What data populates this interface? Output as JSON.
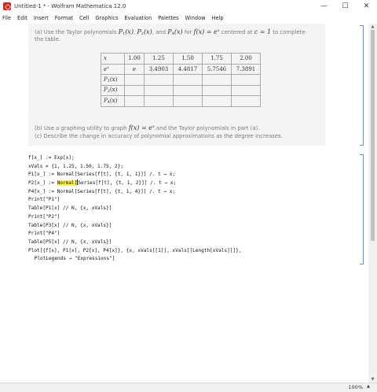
{
  "window": {
    "title": "Untitled-1 * - Wolfram Mathematica 12.0",
    "minimize": "—",
    "maximize": "☐",
    "close": "✕"
  },
  "menu": [
    "File",
    "Edit",
    "Insert",
    "Format",
    "Cell",
    "Graphics",
    "Evaluation",
    "Palettes",
    "Window",
    "Help"
  ],
  "text_cell": {
    "line_a1": "(a) Use the Taylor polynomials",
    "line_a_p1": "P",
    "line_a_p1_sub": "1",
    "line_a_arg": "(x)",
    "line_a_comma": ",",
    "line_a_p2": "P",
    "line_a_p2_sub": "2",
    "line_a_and": ", and",
    "line_a_p4": "P",
    "line_a_p4_sub": "4",
    "line_a_for": "for",
    "line_a_fx": "f(x) = e",
    "line_a_fx_sup": "x",
    "line_a_centered": "centered at",
    "line_a_c": "c = 1",
    "line_a_end": "to complete",
    "line_a2": "the table.",
    "line_b1": "(b) Use a graphing utility to graph",
    "line_b_fx": "f(x) = e",
    "line_b_fx_sup": "x",
    "line_b_end": "and the Taylor polynomials in part (a).",
    "line_c": "(c) Describe the change in accuracy of polynomial approximations as the degree increases."
  },
  "table": {
    "header": [
      "x",
      "1.00",
      "1.25",
      "1.50",
      "1.75",
      "2.00"
    ],
    "ex_label": "e",
    "ex_sup": "x",
    "ex_values": [
      "e",
      "3.4903",
      "4.4817",
      "5.7546",
      "7.3891"
    ],
    "rows": [
      {
        "label": "P",
        "sub": "1",
        "arg": "(x)"
      },
      {
        "label": "P",
        "sub": "2",
        "arg": "(x)"
      },
      {
        "label": "P",
        "sub": "4",
        "arg": "(x)"
      }
    ]
  },
  "code": {
    "l1": "f[x_] := Exp[x];",
    "l2": "xVals = {1, 1.25, 1.50, 1.75, 2};",
    "l3": "P1[x_] := Normal[Series[f[t], {t, 1, 1}]] /. t → x;",
    "l4_pre": "P2[x_] := ",
    "l4_hl": "Normal[",
    "l4_post": "Series[f[t], {t, 1, 2}]] /. t → x;",
    "l5": "P4[x_] := Normal[Series[f[t], {t, 1, 4}]] /. t → x;",
    "l6": "Print[\"P1\"]",
    "l7": "Table[P1[x] // N, {x, xVals}]",
    "l8": "Print[\"P2\"]",
    "l9": "Table[P3[x] // N, {x, xVals}]",
    "l10": "Print[\"P4\"]",
    "l11": "Table[P5[x] // N, {x, xVals}]",
    "l12": "Plot[{f[x], P1[x], P2[x], P4[x]}, {x, xVals[[1]], xVals[[Length[xVals]]]},",
    "l13": " PlotLegends → \"Expressions\"]"
  },
  "status": {
    "zoom": "100%",
    "zoom_arrow": "▲"
  },
  "colors": {
    "text_cell_bg": "#f4f4f4",
    "text_gray": "#7b7b7b",
    "highlight": "#fff24a",
    "bracket": "#6a8cc6",
    "app_icon": "#d9241c"
  }
}
